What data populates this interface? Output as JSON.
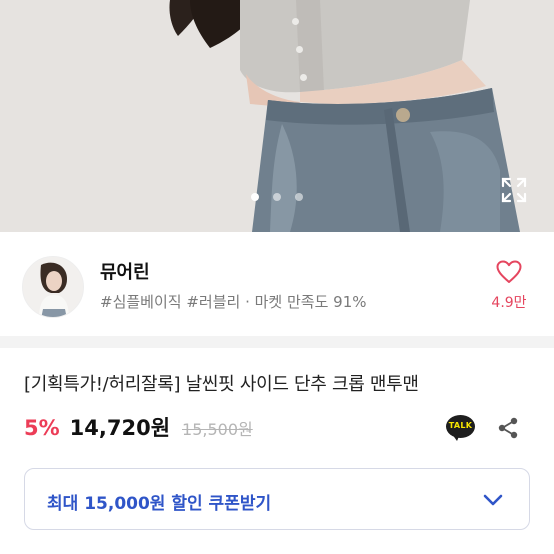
{
  "gallery": {
    "image_description_icon": "product-photo",
    "dots": [
      {
        "active": true
      },
      {
        "active": false
      },
      {
        "active": false
      }
    ]
  },
  "seller": {
    "name": "뮤어린",
    "tags": "#심플베이직 #러블리 · 마켓 만족도 91%",
    "likes": "4.9만"
  },
  "product": {
    "title": "[기획특가!/허리잘록] 날씬핏 사이드 단추 크롭 맨투맨",
    "discount": "5%",
    "price": "14,720원",
    "original_price": "15,500원",
    "talk_label": "TALK"
  },
  "coupon": {
    "label": "최대 15,000원 할인 쿠폰받기"
  },
  "colors": {
    "accent_red": "#ec3d57",
    "coupon_blue": "#2f55c8",
    "like_pink": "#e5465f"
  }
}
